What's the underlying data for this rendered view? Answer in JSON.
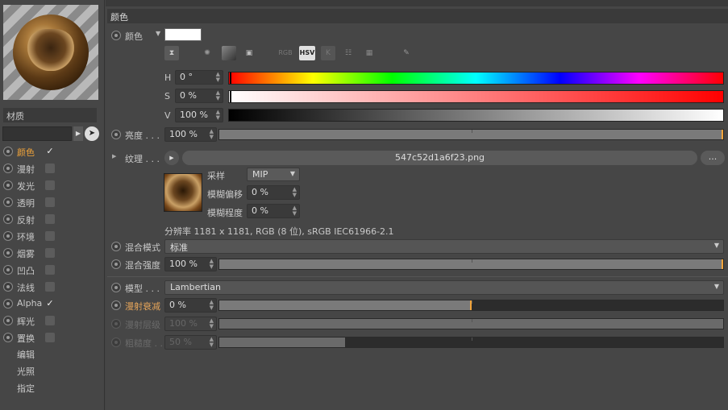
{
  "sidebar": {
    "material_label": "材质",
    "channels": [
      {
        "label": "颜色",
        "checked": true,
        "selected": true
      },
      {
        "label": "漫射",
        "checked": false
      },
      {
        "label": "发光",
        "checked": false
      },
      {
        "label": "透明",
        "checked": false
      },
      {
        "label": "反射",
        "checked": false
      },
      {
        "label": "环境",
        "checked": false
      },
      {
        "label": "烟雾",
        "checked": false
      },
      {
        "label": "凹凸",
        "checked": false
      },
      {
        "label": "法线",
        "checked": false
      },
      {
        "label": "Alpha",
        "checked": true
      },
      {
        "label": "辉光",
        "checked": false
      },
      {
        "label": "置换",
        "checked": false
      }
    ],
    "extra_items": [
      "编辑",
      "光照",
      "指定"
    ],
    "check_mark": "✓"
  },
  "section": {
    "title": "颜色"
  },
  "color": {
    "label": "颜色",
    "swatch": "#ffffff",
    "toolbar": {
      "rgb": "RGB",
      "hsv": "HSV",
      "k": "K"
    },
    "h": {
      "label": "H",
      "value": "0 °"
    },
    "s": {
      "label": "S",
      "value": "0 %"
    },
    "v": {
      "label": "V",
      "value": "100 %"
    }
  },
  "brightness": {
    "label": "亮度 . . .",
    "value": "100 %",
    "level": 1.0
  },
  "texture": {
    "label": "纹理 . . .",
    "filename": "547c52d1a6f23.png",
    "more": "...",
    "sampling_label": "采样",
    "sampling_value": "MIP",
    "blur_offset_label": "模糊偏移",
    "blur_offset_value": "0 %",
    "blur_scale_label": "模糊程度",
    "blur_scale_value": "0 %",
    "info": "分辨率 1181 x 1181, RGB (8 位), sRGB IEC61966-2.1"
  },
  "mix_mode": {
    "label": "混合模式",
    "value": "标准"
  },
  "mix_strength": {
    "label": "混合强度",
    "value": "100 %",
    "level": 1.0
  },
  "model": {
    "label": "模型 . . .",
    "value": "Lambertian"
  },
  "diffuse_falloff": {
    "label": "漫射衰减",
    "value": "0 %",
    "level": 0.5
  },
  "diffuse_level": {
    "label": "漫射层级",
    "value": "100 %",
    "level": 1.0
  },
  "roughness": {
    "label": "粗糙度 . .",
    "value": "50 %",
    "level": 0.25
  },
  "colors": {
    "accent": "#f2a43a",
    "bg": "#464646"
  }
}
